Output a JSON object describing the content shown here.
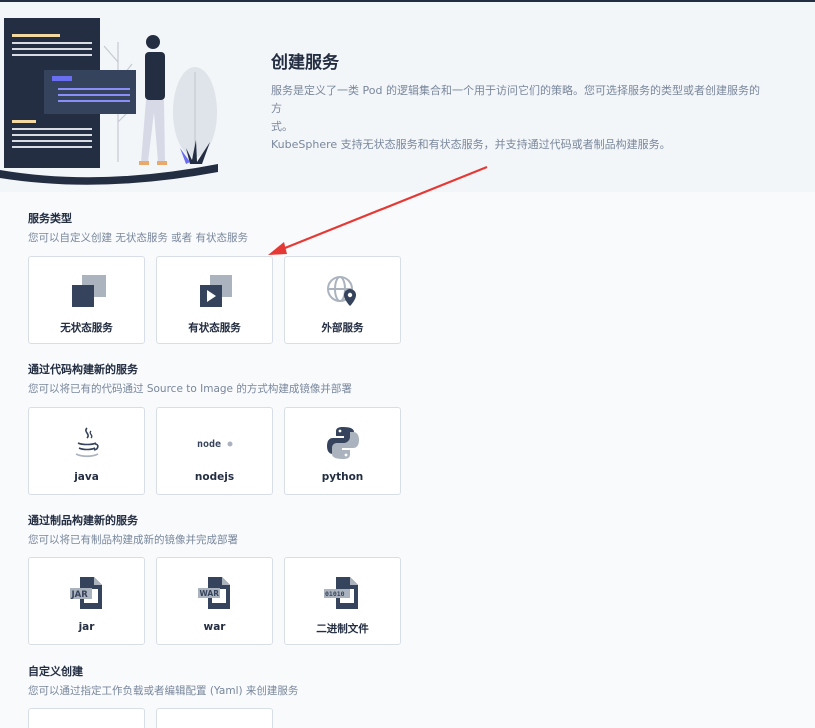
{
  "header": {
    "title": "创建服务",
    "desc_line1": "服务是定义了一类 Pod 的逻辑集合和一个用于访问它们的策略。您可选择服务的类型或者创建服务的方",
    "desc_line2": "式。",
    "desc_line3": "KubeSphere 支持无状态服务和有状态服务，并支持通过代码或者制品构建服务。"
  },
  "sections": [
    {
      "title": "服务类型",
      "subtitle": "您可以自定义创建 无状态服务 或者 有状态服务",
      "cards": [
        {
          "label": "无状态服务",
          "icon": "stateless-service-icon"
        },
        {
          "label": "有状态服务",
          "icon": "stateful-service-icon"
        },
        {
          "label": "外部服务",
          "icon": "external-service-icon"
        }
      ]
    },
    {
      "title": "通过代码构建新的服务",
      "subtitle": "您可以将已有的代码通过 Source to Image 的方式构建成镜像并部署",
      "cards": [
        {
          "label": "java",
          "icon": "java-icon"
        },
        {
          "label": "nodejs",
          "icon": "nodejs-icon",
          "icon_text": "node"
        },
        {
          "label": "python",
          "icon": "python-icon"
        }
      ]
    },
    {
      "title": "通过制品构建新的服务",
      "subtitle": "您可以将已有制品构建成新的镜像并完成部署",
      "cards": [
        {
          "label": "jar",
          "icon": "jar-file-icon",
          "icon_text": "JAR"
        },
        {
          "label": "war",
          "icon": "war-file-icon",
          "icon_text": "WAR"
        },
        {
          "label": "二进制文件",
          "icon": "binary-file-icon",
          "icon_text": "01010"
        }
      ]
    },
    {
      "title": "自定义创建",
      "subtitle": "您可以通过指定工作负载或者编辑配置 (Yaml) 来创建服务"
    }
  ],
  "colors": {
    "accent_red": "#e53935",
    "icon_dark": "#36435c",
    "icon_light": "#abb4be",
    "text_primary": "#242e42",
    "text_secondary": "#79879c"
  }
}
